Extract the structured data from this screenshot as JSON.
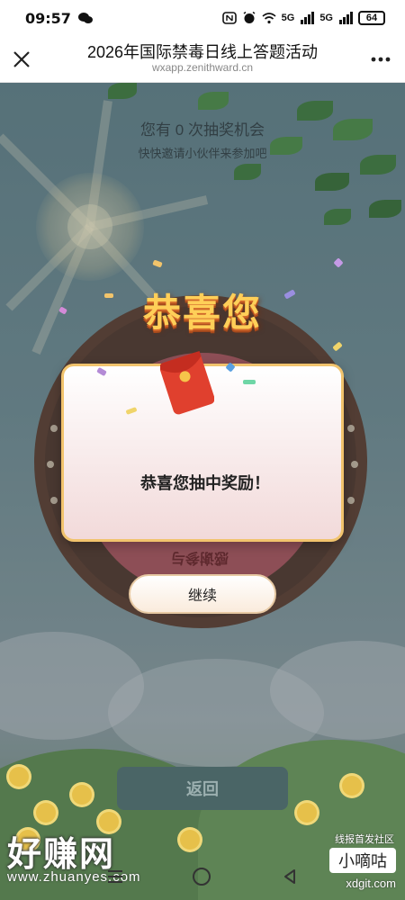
{
  "status_bar": {
    "time": "09:57",
    "network_1": "5G",
    "network_2": "5G",
    "battery": "64"
  },
  "nav": {
    "title": "2026年国际禁毒日线上答题活动",
    "url": "wxapp.zenithward.cn",
    "close_icon": "close-icon",
    "more_icon": "more-icon"
  },
  "page": {
    "chances_text": "您有 0 次抽奖机会",
    "invite_text": "快快邀请小伙伴来参加吧",
    "wheel_segment_label": "感谢参与"
  },
  "modal": {
    "title": "恭喜您",
    "message": "恭喜您抽中奖励！",
    "continue_label": "继续",
    "envelope_icon": "red-envelope-icon"
  },
  "footer": {
    "back_label": "返回"
  },
  "watermarks": {
    "left_brand": "好赚网",
    "left_url": "www.zhuanyes.com",
    "right_top": "线报首发社区",
    "right_brand": "小嘀咕",
    "right_url": "xdgit.com"
  },
  "colors": {
    "title_gold": "#ffcf58",
    "card_border": "#f1c36d",
    "back_button": "#4a6566"
  }
}
